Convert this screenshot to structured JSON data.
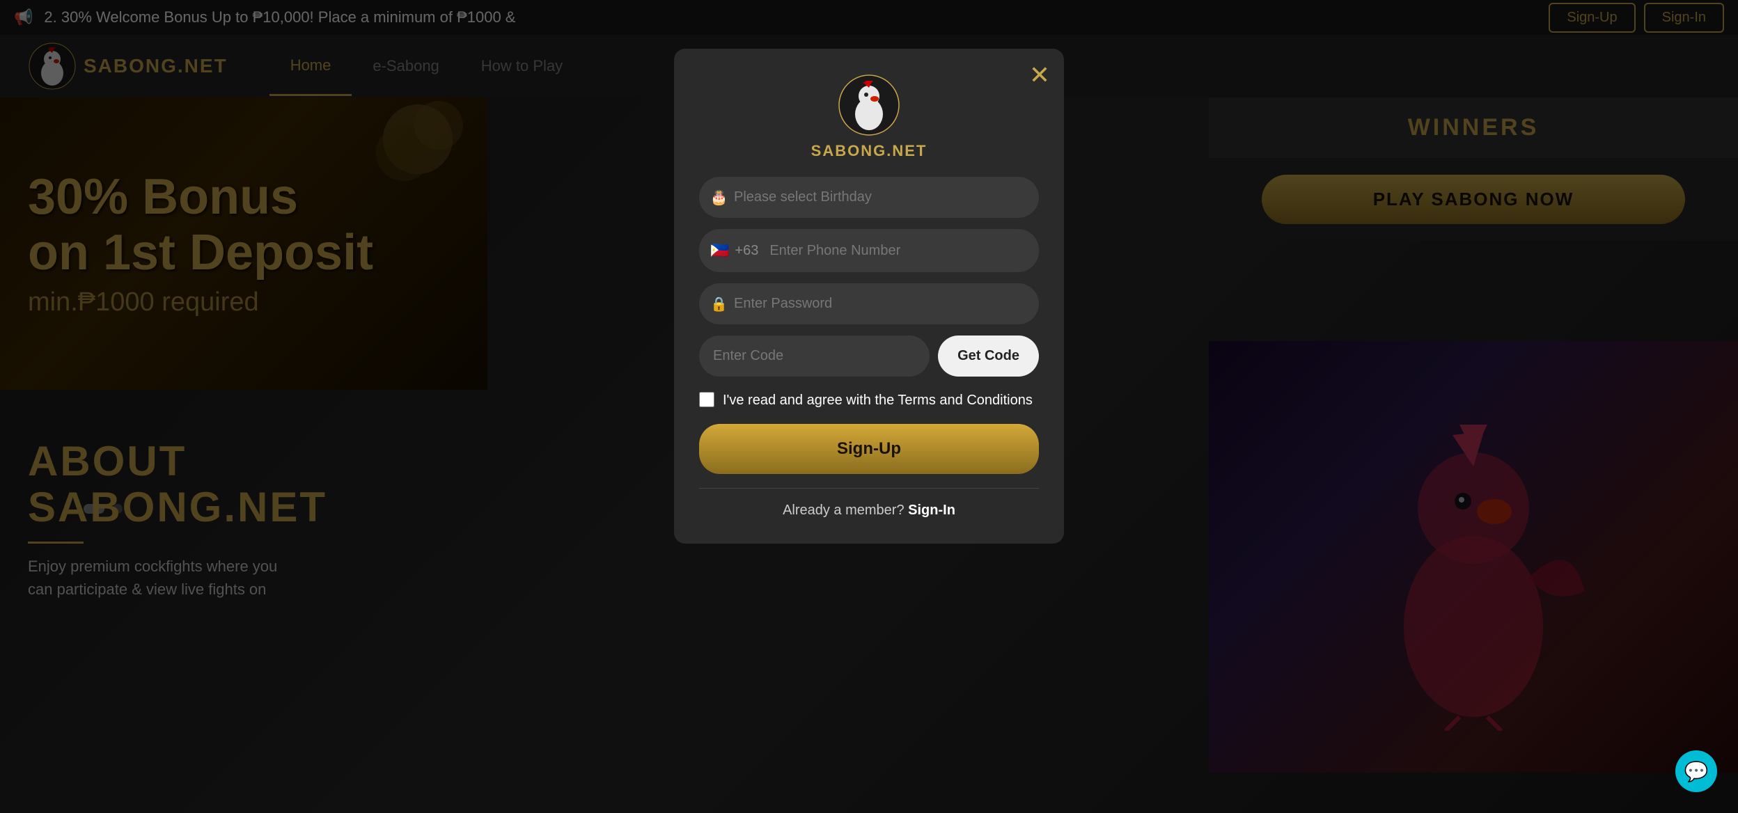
{
  "announcement": {
    "icon": "📢",
    "text": "2. 30% Welcome Bonus Up to ₱10,000! Place a minimum of ₱1000 &",
    "signup_label": "Sign-Up",
    "signin_label": "Sign-In"
  },
  "navbar": {
    "logo_text": "SABONG.NET",
    "links": [
      {
        "label": "Home",
        "active": true
      },
      {
        "label": "e-Sabong",
        "active": false
      },
      {
        "label": "How to Play",
        "active": false
      }
    ]
  },
  "hero": {
    "line1": "30% Bonus",
    "line2": "on 1st Deposit",
    "line3": "min.₱1000 required"
  },
  "about": {
    "title_line1": "ABOUT",
    "title_line2": "SABONG.NET",
    "text_line1": "Enjoy premium cockfights where you",
    "text_line2": "can participate & view live fights on"
  },
  "winners": {
    "title": "WINNERS",
    "play_button": "PLAY SABONG NOW"
  },
  "modal": {
    "logo_text": "SABONG.NET",
    "close_label": "✕",
    "birthday_placeholder": "Please select Birthday",
    "phone_prefix": "+63",
    "phone_flag": "🇵🇭",
    "phone_placeholder": "Enter Phone Number",
    "password_placeholder": "Enter Password",
    "code_placeholder": "Enter Code",
    "get_code_label": "Get Code",
    "terms_text": "I've read and agree with the Terms and Conditions",
    "signup_label": "Sign-Up",
    "already_member": "Already a member?",
    "signin_label": "Sign-In"
  },
  "chat": {
    "icon": "💬"
  }
}
